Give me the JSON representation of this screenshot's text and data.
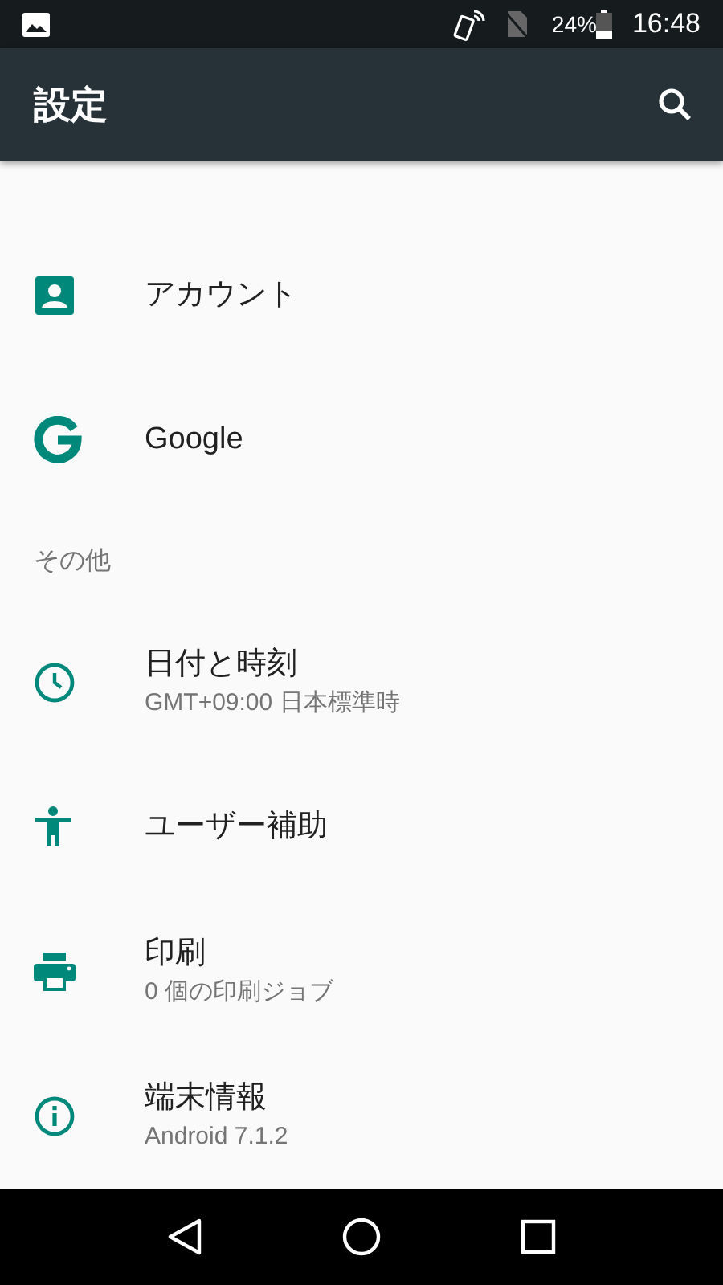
{
  "status_bar": {
    "battery": "24%",
    "time": "16:48"
  },
  "toolbar": {
    "title": "設定"
  },
  "list": [
    {
      "kind": "setting",
      "title": "アカウント"
    },
    {
      "kind": "setting",
      "title": "Google"
    },
    {
      "kind": "header",
      "title": "その他"
    },
    {
      "kind": "setting",
      "title": "日付と時刻",
      "summary": "GMT+09:00 日本標準時"
    },
    {
      "kind": "setting",
      "title": "ユーザー補助"
    },
    {
      "kind": "setting",
      "title": "印刷",
      "summary": "0 個の印刷ジョブ"
    },
    {
      "kind": "setting",
      "title": "端末情報",
      "summary": "Android 7.1.2"
    }
  ]
}
